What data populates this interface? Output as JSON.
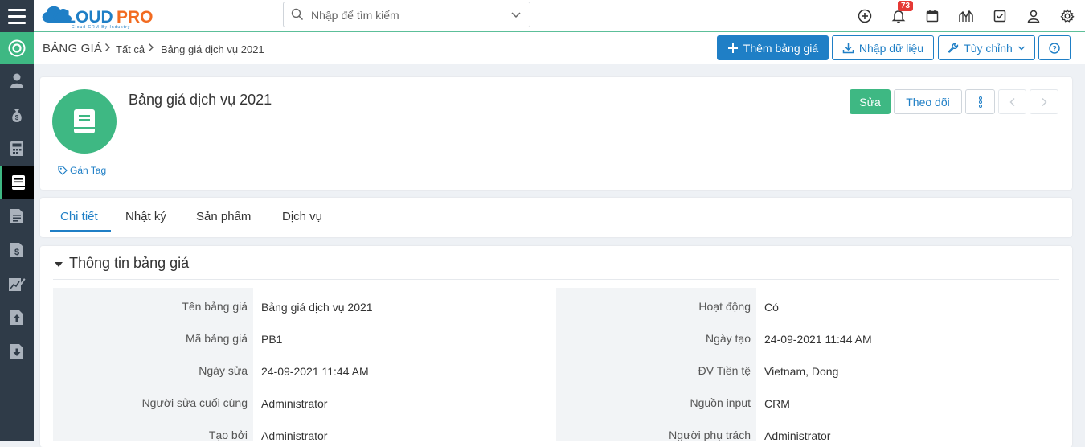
{
  "app": {
    "logo_text": "CLOUDPRO",
    "logo_sub": "Cloud CRM By Industry"
  },
  "search": {
    "placeholder": "Nhập để tìm kiếm"
  },
  "notifications": {
    "count": "73"
  },
  "breadcrumb": {
    "module": "BẢNG GIÁ",
    "filter": "Tất cả",
    "record": "Bảng giá dịch vụ 2021"
  },
  "actions": {
    "add": "Thêm bảng giá",
    "import": "Nhập dữ liệu",
    "customize": "Tùy chỉnh"
  },
  "record": {
    "title": "Bảng giá dịch vụ 2021",
    "tag_label": "Gán Tag",
    "edit": "Sửa",
    "follow": "Theo dõi"
  },
  "tabs": [
    "Chi tiết",
    "Nhật ký",
    "Sản phẩm",
    "Dịch vụ"
  ],
  "section": {
    "title": "Thông tin bảng giá"
  },
  "fields_left": [
    {
      "label": "Tên bảng giá",
      "value": "Bảng giá dịch vụ 2021"
    },
    {
      "label": "Mã bảng giá",
      "value": "PB1"
    },
    {
      "label": "Ngày sửa",
      "value": "24-09-2021 11:44 AM"
    },
    {
      "label": "Người sửa cuối cùng",
      "value": "Administrator"
    },
    {
      "label": "Tạo bởi",
      "value": "Administrator"
    }
  ],
  "fields_right": [
    {
      "label": "Hoạt động",
      "value": "Có"
    },
    {
      "label": "Ngày tạo",
      "value": "24-09-2021 11:44 AM"
    },
    {
      "label": "ĐV Tiền tệ",
      "value": "Vietnam, Dong"
    },
    {
      "label": "Nguồn input",
      "value": "CRM"
    },
    {
      "label": "Người phụ trách",
      "value": "Administrator"
    }
  ],
  "colors": {
    "primary": "#1f7fc6",
    "green": "#3eb883",
    "sidebar": "#2f3b48",
    "logo_orange": "#f26b21"
  }
}
